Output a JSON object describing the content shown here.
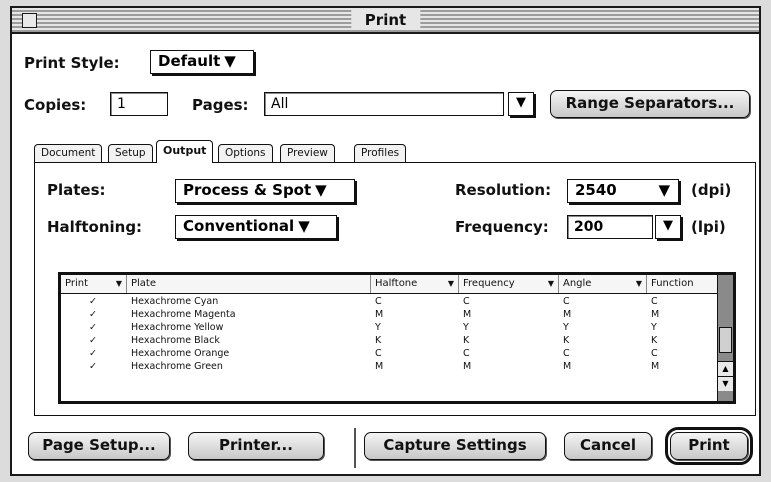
{
  "window": {
    "title": "Print"
  },
  "print_style": {
    "label": "Print Style:",
    "value": "Default"
  },
  "copies": {
    "label": "Copies:",
    "value": "1"
  },
  "pages": {
    "label": "Pages:",
    "value": "All"
  },
  "range_separators_button": "Range Separators...",
  "tabs": [
    "Document",
    "Setup",
    "Output",
    "Options",
    "Preview",
    "Profiles"
  ],
  "active_tab": "Output",
  "output": {
    "plates_label": "Plates:",
    "plates_value": "Process & Spot",
    "halftoning_label": "Halftoning:",
    "halftoning_value": "Conventional",
    "resolution_label": "Resolution:",
    "resolution_value": "2540",
    "resolution_unit": "(dpi)",
    "frequency_label": "Frequency:",
    "frequency_value": "200",
    "frequency_unit": "(lpi)"
  },
  "table": {
    "columns": [
      "Print",
      "Plate",
      "Halftone",
      "Frequency",
      "Angle",
      "Function"
    ],
    "rows": [
      [
        "✓",
        "Hexachrome Cyan",
        "C",
        "C",
        "C",
        "C"
      ],
      [
        "✓",
        "Hexachrome Magenta",
        "M",
        "M",
        "M",
        "M"
      ],
      [
        "✓",
        "Hexachrome Yellow",
        "Y",
        "Y",
        "Y",
        "Y"
      ],
      [
        "✓",
        "Hexachrome Black",
        "K",
        "K",
        "K",
        "K"
      ],
      [
        "✓",
        "Hexachrome Orange",
        "C",
        "C",
        "C",
        "C"
      ],
      [
        "✓",
        "Hexachrome Green",
        "M",
        "M",
        "M",
        "M"
      ]
    ]
  },
  "buttons": {
    "page_setup": "Page Setup...",
    "printer": "Printer...",
    "capture_settings": "Capture Settings",
    "cancel": "Cancel",
    "print": "Print"
  },
  "icons": {
    "close_box": "close-box-icon",
    "popup_arrow": "▼",
    "scroll_up": "▲",
    "scroll_down": "▼"
  }
}
